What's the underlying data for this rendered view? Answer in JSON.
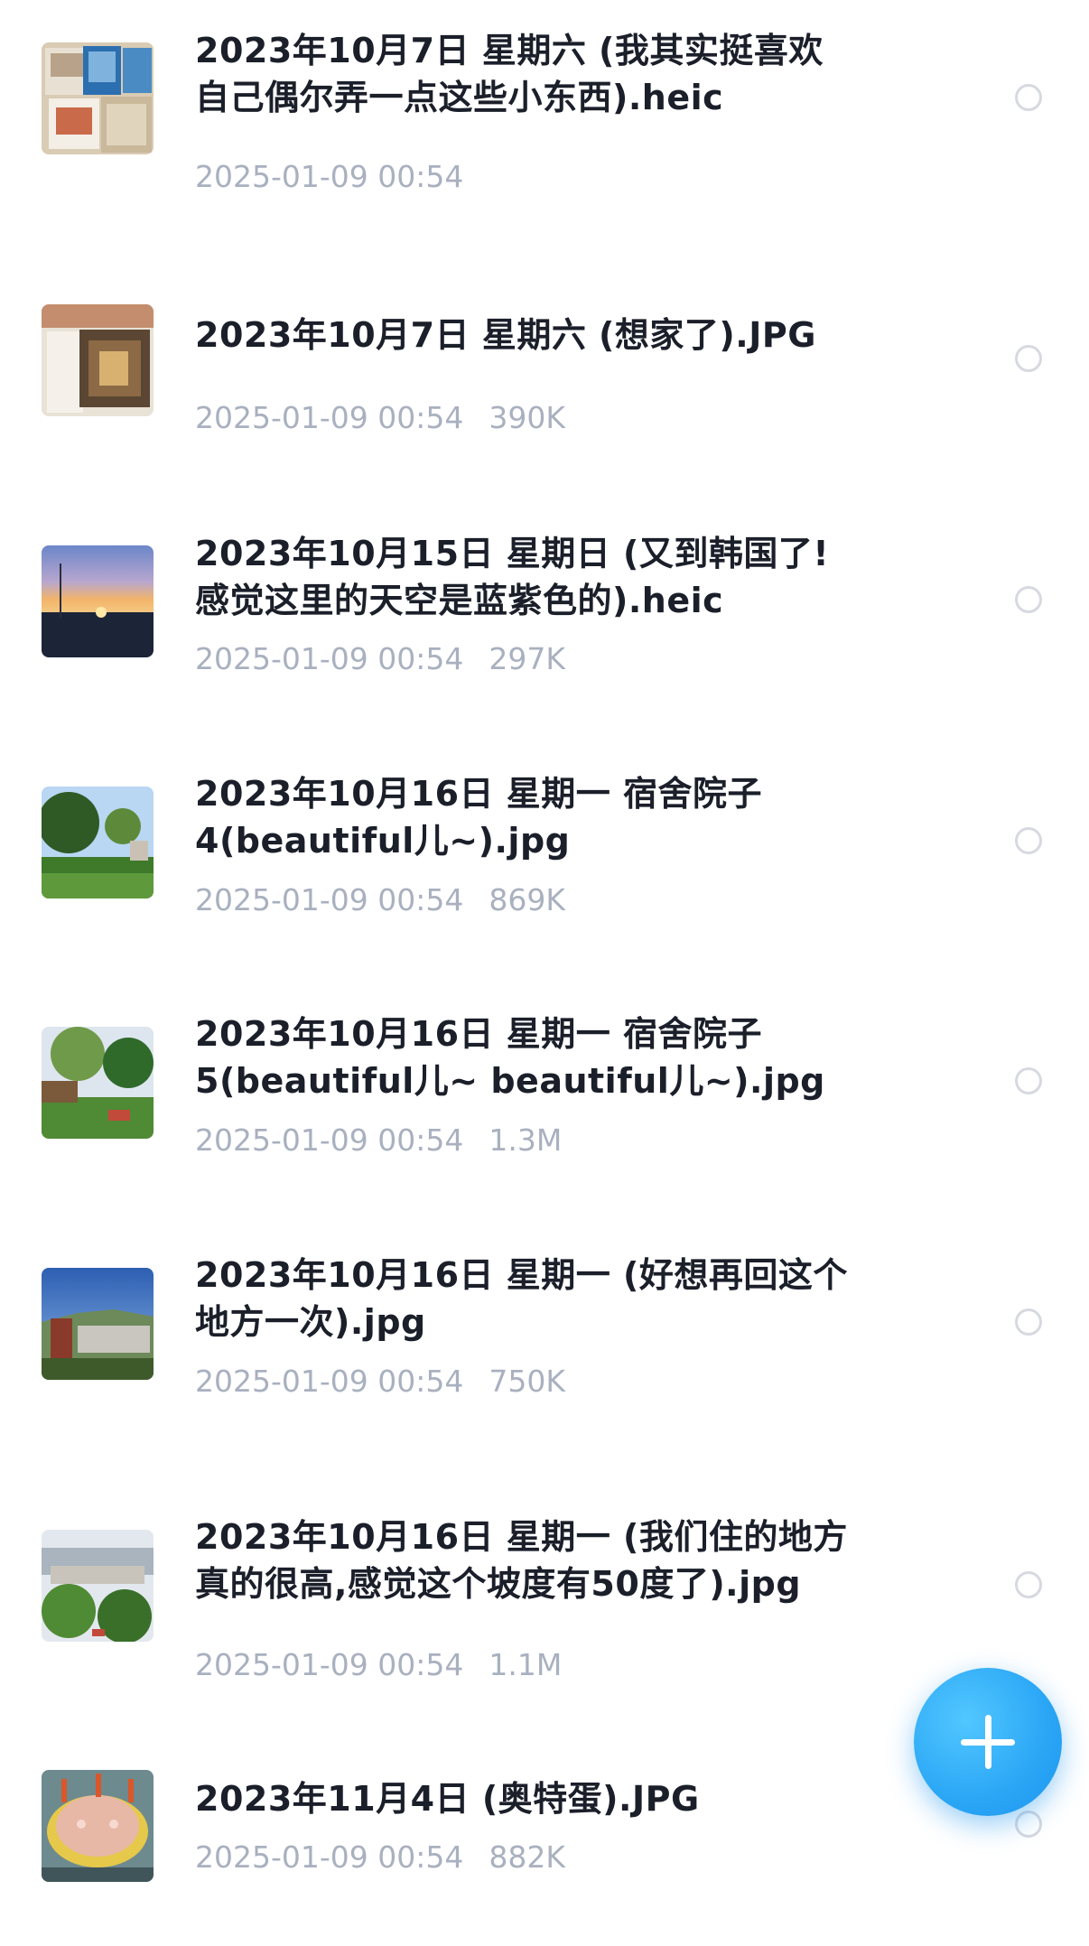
{
  "files": [
    {
      "name": "2023年10月7日 星期六 (我其实挺喜欢\n自己偶尔弄一点这些小东西).heic",
      "date": "2025-01-09 00:54",
      "size": "",
      "thumb_icon": "photo-collage-thumbnail"
    },
    {
      "name": "2023年10月7日 星期六 (想家了).JPG",
      "date": "2025-01-09 00:54",
      "size": "390K",
      "thumb_icon": "photo-frame-thumbnail"
    },
    {
      "name": "2023年10月15日 星期日 (又到韩国了!\n感觉这里的天空是蓝紫色的).heic",
      "date": "2025-01-09 00:54",
      "size": "297K",
      "thumb_icon": "sunset-sky-thumbnail"
    },
    {
      "name": "2023年10月16日 星期一 宿舍院子\n4(beautiful儿~).jpg",
      "date": "2025-01-09 00:54",
      "size": "869K",
      "thumb_icon": "garden-thumbnail"
    },
    {
      "name": "2023年10月16日 星期一 宿舍院子\n5(beautiful儿~ beautiful儿~).jpg",
      "date": "2025-01-09 00:54",
      "size": "1.3M",
      "thumb_icon": "garden-tree-thumbnail"
    },
    {
      "name": "2023年10月16日 星期一 (好想再回这个\n地方一次).jpg",
      "date": "2025-01-09 00:54",
      "size": "750K",
      "thumb_icon": "city-view-thumbnail"
    },
    {
      "name": "2023年10月16日 星期一 (我们住的地方\n真的很高,感觉这个坡度有50度了).jpg",
      "date": "2025-01-09 00:54",
      "size": "1.1M",
      "thumb_icon": "hillside-town-thumbnail"
    },
    {
      "name": "2023年11月4日 (奥特蛋).JPG",
      "date": "2025-01-09 00:54",
      "size": "882K",
      "thumb_icon": "toy-egg-thumbnail"
    }
  ],
  "fab": {
    "icon": "plus-icon"
  },
  "colors": {
    "title": "#1b1f2a",
    "meta": "#a9b0bf",
    "radio_border": "#d6d9e0",
    "fab_blue": "#2aa6f5"
  }
}
